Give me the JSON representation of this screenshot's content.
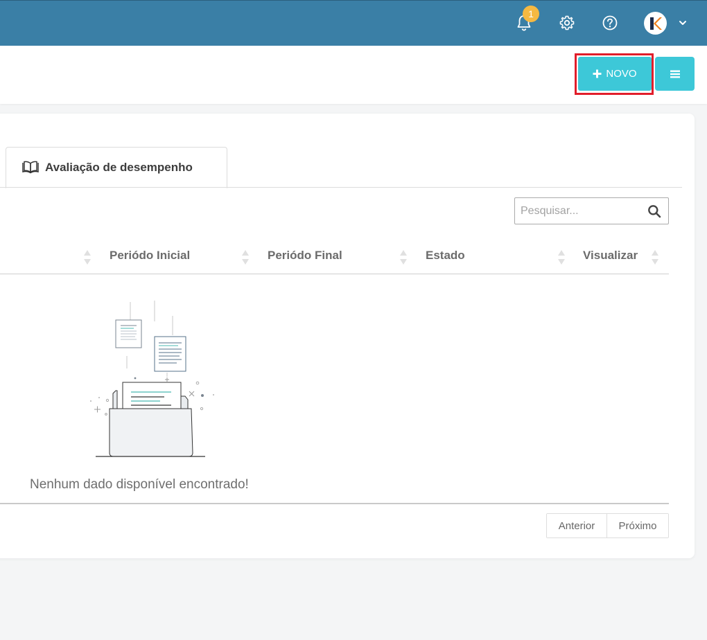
{
  "header": {
    "notification_count": "1",
    "icons": [
      "bell-icon",
      "gear-icon",
      "help-icon",
      "avatar",
      "chevron-down-icon"
    ],
    "color": "#3a7fa6"
  },
  "toolbar": {
    "new_label": "NOVO",
    "new_icon": "plus-icon",
    "menu_icon": "hamburger-icon",
    "accent": "#3dc8d8",
    "highlight": "#e11d2a"
  },
  "tab": {
    "label": "Avaliação de desempenho",
    "icon": "open-book-icon"
  },
  "search": {
    "placeholder": "Pesquisar...",
    "value": ""
  },
  "table": {
    "columns": [
      "Periódo Inicial",
      "Periódo Final",
      "Estado",
      "Visualizar"
    ],
    "rows": [],
    "empty_message": "Nenhum dado disponível encontrado!"
  },
  "pagination": {
    "prev_label": "Anterior",
    "next_label": "Próximo"
  }
}
